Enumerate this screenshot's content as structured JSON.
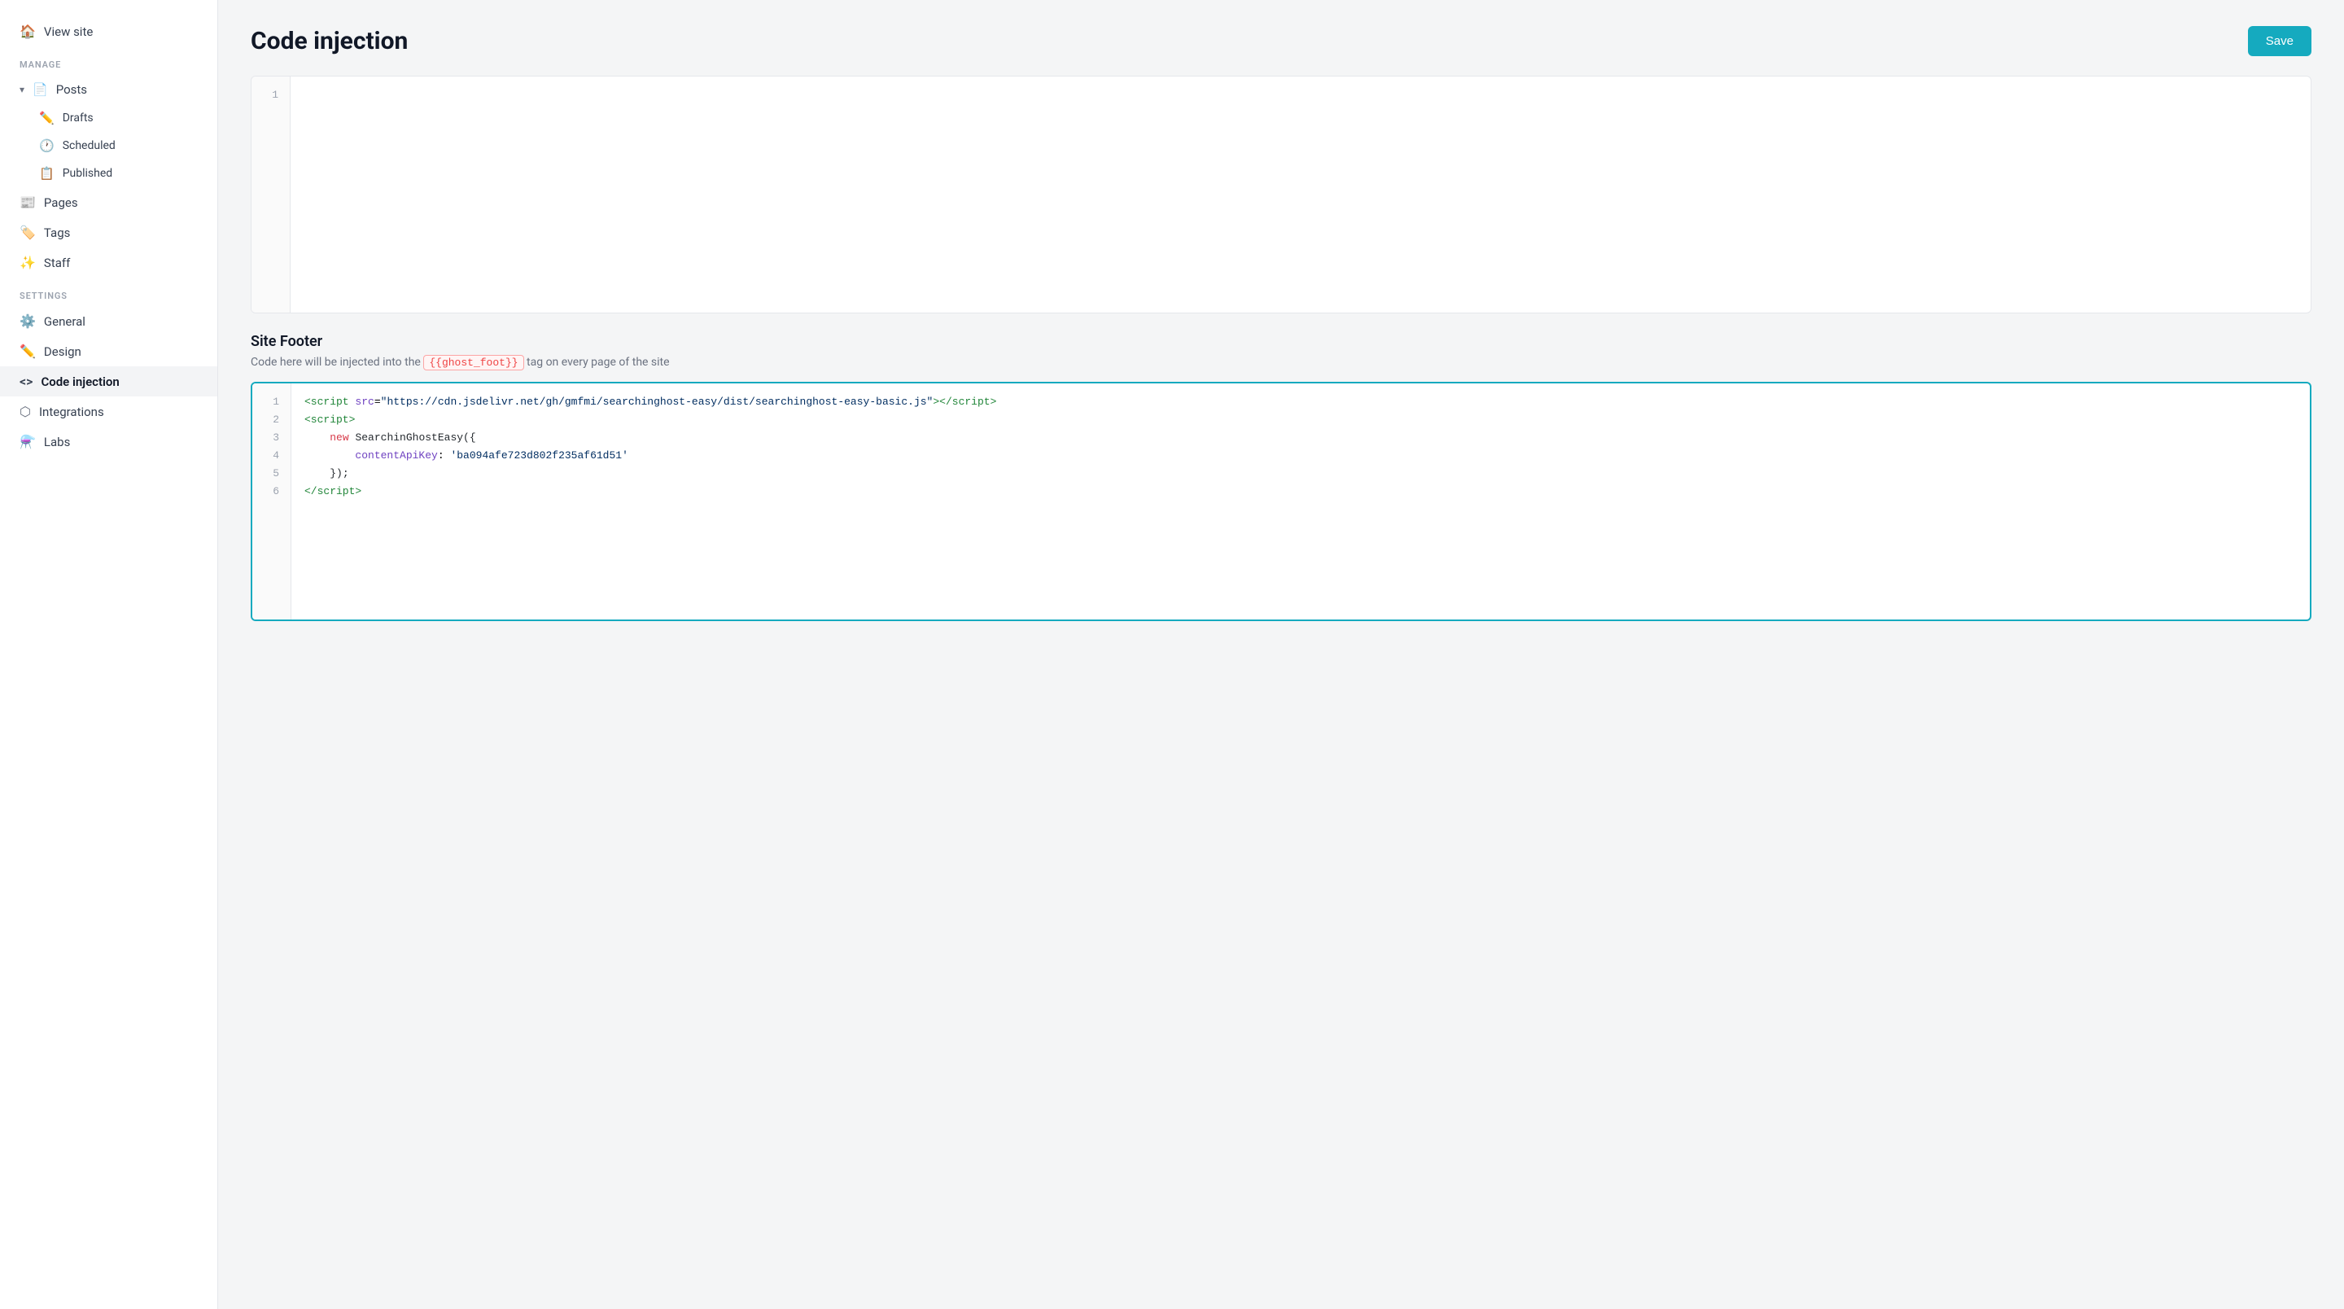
{
  "sidebar": {
    "nav": [
      {
        "id": "view-site",
        "label": "View site",
        "icon": "🏠"
      }
    ],
    "manage_label": "MANAGE",
    "posts": {
      "label": "Posts",
      "icon": "📄",
      "children": [
        {
          "id": "drafts",
          "label": "Drafts",
          "icon": "✏️"
        },
        {
          "id": "scheduled",
          "label": "Scheduled",
          "icon": "🕐"
        },
        {
          "id": "published",
          "label": "Published",
          "icon": "📋"
        }
      ]
    },
    "manage_items": [
      {
        "id": "pages",
        "label": "Pages",
        "icon": "📰"
      },
      {
        "id": "tags",
        "label": "Tags",
        "icon": "🏷️"
      },
      {
        "id": "staff",
        "label": "Staff",
        "icon": "✨"
      }
    ],
    "settings_label": "SETTINGS",
    "settings_items": [
      {
        "id": "general",
        "label": "General",
        "icon": "⚙️"
      },
      {
        "id": "design",
        "label": "Design",
        "icon": "✏️"
      },
      {
        "id": "code-injection",
        "label": "Code injection",
        "icon": "◇",
        "active": true
      },
      {
        "id": "integrations",
        "label": "Integrations",
        "icon": "⬡"
      },
      {
        "id": "labs",
        "label": "Labs",
        "icon": "⚗️"
      }
    ]
  },
  "page": {
    "title": "Code injection",
    "save_button": "Save"
  },
  "site_footer": {
    "title": "Site Footer",
    "description_before": "Code here will be injected into the",
    "tag": "{{ghost_foot}}",
    "description_after": "tag on every page of the site"
  },
  "footer_code": {
    "lines": [
      {
        "num": "1",
        "content": "<script src=\"https://cdn.jsdelivr.net/gh/gmfmi/searchinghost-easy/dist/searchinghost-easy-basic.js\"><\\/script>"
      },
      {
        "num": "2",
        "content": "<script>"
      },
      {
        "num": "3",
        "content": "    new SearchinGhostEasy({"
      },
      {
        "num": "4",
        "content": "        contentApiKey: 'ba094afe723d802f235af61d51'"
      },
      {
        "num": "5",
        "content": "    });"
      },
      {
        "num": "6",
        "content": "<\\/script>"
      }
    ]
  }
}
